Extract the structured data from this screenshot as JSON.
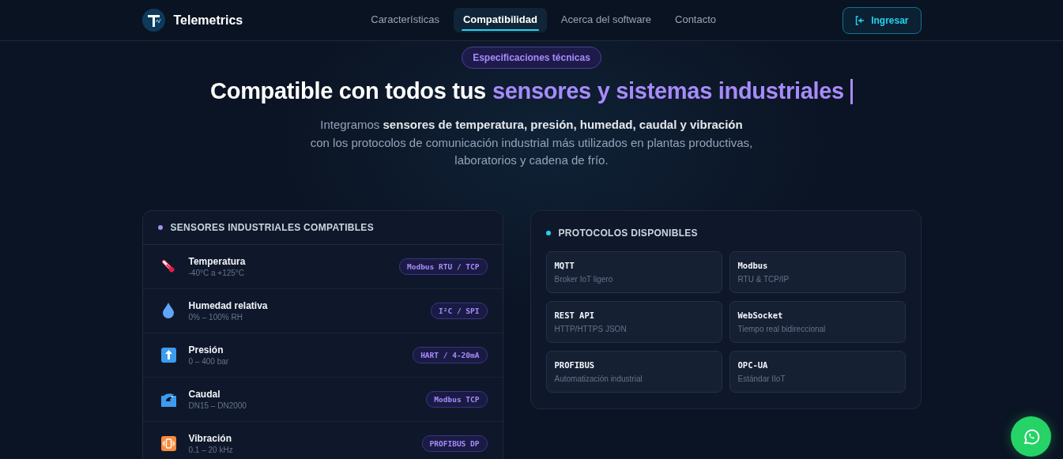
{
  "header": {
    "brand": "Telemetrics",
    "nav": [
      {
        "label": "Características",
        "selected": false
      },
      {
        "label": "Compatibilidad",
        "selected": true
      },
      {
        "label": "Acerca del software",
        "selected": false
      },
      {
        "label": "Contacto",
        "selected": false
      }
    ],
    "login_button": "Ingresar"
  },
  "hero": {
    "badge": "Especificaciones técnicas",
    "title": "Compatible con todos tus",
    "title_highlight": "sensores y sistemas industriales",
    "subtitle": "Integramos **sensores de temperatura, presión, humedad, caudal y vibración** con los protocolos de comunicación industrial más utilizados en plantas productivas, laboratorios y cadena de frío."
  },
  "sensors": {
    "title": "SENSORES INDUSTRIALES COMPATIBLES",
    "items": [
      {
        "kind": "thermometer",
        "name": "Temperatura",
        "range": "-40°C a +125°C",
        "protocol": "Modbus RTU / TCP"
      },
      {
        "kind": "droplet",
        "name": "Humedad relativa",
        "range": "0% – 100% RH",
        "protocol": "I²C / SPI"
      },
      {
        "kind": "arrow",
        "name": "Presión",
        "range": "0 – 400 bar",
        "protocol": "HART / 4-20mA"
      },
      {
        "kind": "wave",
        "name": "Caudal",
        "range": "DN15 – DN2000",
        "protocol": "Modbus TCP"
      },
      {
        "kind": "vibration",
        "name": "Vibración",
        "range": "0.1 – 20 kHz",
        "protocol": "PROFIBUS DP"
      }
    ]
  },
  "protocols": {
    "title": "PROTOCOLOS DISPONIBLES",
    "items": [
      {
        "name": "MQTT",
        "description": "Broker IoT ligero"
      },
      {
        "name": "Modbus",
        "description": "RTU & TCP/IP"
      },
      {
        "name": "REST API",
        "description": "HTTP/HTTPS JSON"
      },
      {
        "name": "WebSocket",
        "description": "Tiempo real bidireccional"
      },
      {
        "name": "PROFIBUS",
        "description": "Automatización industrial"
      },
      {
        "name": "OPC-UA",
        "description": "Estándar IIoT"
      }
    ]
  }
}
